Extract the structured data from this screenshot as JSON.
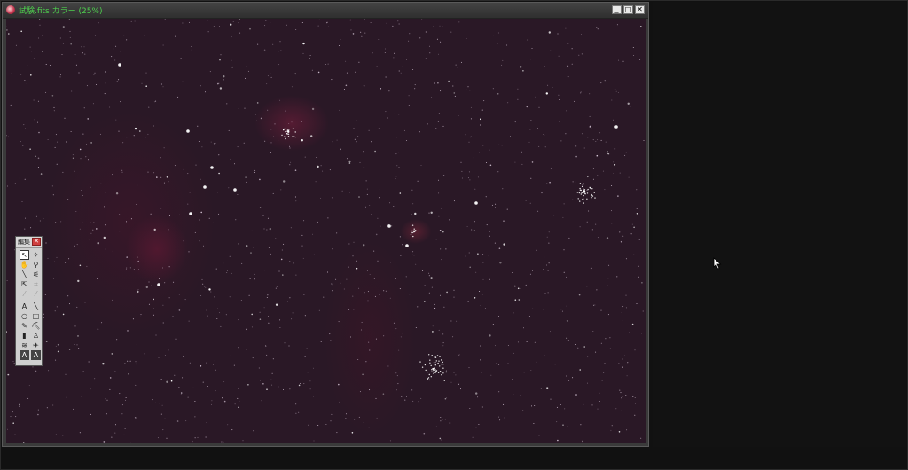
{
  "window": {
    "title": "試験.fits カラー (25%)",
    "buttons": {
      "minimize": "_",
      "maximize": "□",
      "close": "✕"
    }
  },
  "palette": {
    "title": "編集",
    "close_label": "✕",
    "tools": [
      {
        "name": "select-arrow-tool",
        "glyph": "↖",
        "state": "selected"
      },
      {
        "name": "magic-wand-tool",
        "glyph": "✧",
        "state": "normal"
      },
      {
        "name": "hand-tool",
        "glyph": "✋",
        "state": "dim"
      },
      {
        "name": "zoom-tool",
        "glyph": "⚲",
        "state": "normal"
      },
      {
        "name": "measure-tool",
        "glyph": "╲",
        "state": "normal"
      },
      {
        "name": "eyedropper-tool",
        "glyph": "⚟",
        "state": "normal"
      },
      {
        "name": "transform-tool",
        "glyph": "⇱",
        "state": "normal"
      },
      {
        "name": "crop-tool",
        "glyph": "⌗",
        "state": "dim"
      },
      {
        "name": "brush-tool",
        "glyph": "⁄",
        "state": "dim"
      },
      {
        "name": "smudge-tool",
        "glyph": "⁄",
        "state": "dim"
      },
      {
        "name": "text-tool",
        "glyph": "A",
        "state": "normal"
      },
      {
        "name": "line-tool",
        "glyph": "╲",
        "state": "normal"
      },
      {
        "name": "ellipse-tool",
        "glyph": "○",
        "state": "normal"
      },
      {
        "name": "rectangle-tool",
        "glyph": "□",
        "state": "normal"
      },
      {
        "name": "pencil-tool",
        "glyph": "✎",
        "state": "normal"
      },
      {
        "name": "fill-tool",
        "glyph": "⛏",
        "state": "normal"
      },
      {
        "name": "eraser-tool",
        "glyph": "▮",
        "state": "normal"
      },
      {
        "name": "stamp-tool",
        "glyph": "♙",
        "state": "normal"
      },
      {
        "name": "gradient-tool",
        "glyph": "≋",
        "state": "normal"
      },
      {
        "name": "airbrush-tool",
        "glyph": "✈",
        "state": "normal"
      },
      {
        "name": "foreground-color",
        "glyph": "A",
        "state": "boxed"
      },
      {
        "name": "background-color",
        "glyph": "A",
        "state": "boxed"
      }
    ]
  },
  "colors": {
    "title_text": "#4ed04e",
    "sky_background": "#2a1826",
    "nebula": "#7a1e3c",
    "desktop": "#111111"
  }
}
